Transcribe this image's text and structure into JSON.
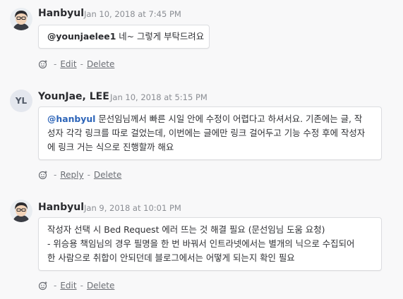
{
  "comments": [
    {
      "author": "Hanbyul",
      "avatar_kind": "illustrated-avatar",
      "timestamp": "Jan 10, 2018 at 7:45 PM",
      "mention": "@younjaelee1",
      "lines": [
        " 네~ 그렇게 부탁드려요"
      ],
      "actions": [
        "Edit",
        "Delete"
      ],
      "separator": "-"
    },
    {
      "author": "YounJae, LEE",
      "initials": "YL",
      "timestamp": "Jan 10, 2018 at 5:15 PM",
      "mention": "@hanbyul",
      "lines": [
        " 문선임님께서 빠른 시일 안에 수정이 어렵다고 하셔서요. 기존에는 글, 작",
        "성자 각각 링크를 따로 걸었는데, 이번에는 글에만 링크 걸어두고 기능 수정 후에 작성자",
        "에 링크 거는 식으로 진행할까 해요"
      ],
      "actions": [
        "Reply",
        "Delete"
      ],
      "separator": "-"
    },
    {
      "author": "Hanbyul",
      "avatar_kind": "illustrated-avatar",
      "timestamp": "Jan 9, 2018 at 10:01 PM",
      "lines": [
        "작성자 선택 시 Bed Request 에러 뜨는 것 해결 필요 (문선임님 도움 요청)",
        "- 위승용 책임님의 경우 필명을 한 번 바꿔서 인트라넷에서는 별개의 닉으로 수집되어",
        "한 사람으로 취합이 안되던데 블로그에서는 어떻게 되는지 확인 필요"
      ],
      "actions": [
        "Edit",
        "Delete"
      ],
      "separator": "-"
    }
  ],
  "colors": {
    "mention": "#2c64b8",
    "background": "#f8f8f9",
    "bubble_border": "#dcdde0",
    "muted": "#8a8d93"
  },
  "icons": {
    "reaction": "add-reaction-icon",
    "avatar": "illustrated-avatar"
  }
}
